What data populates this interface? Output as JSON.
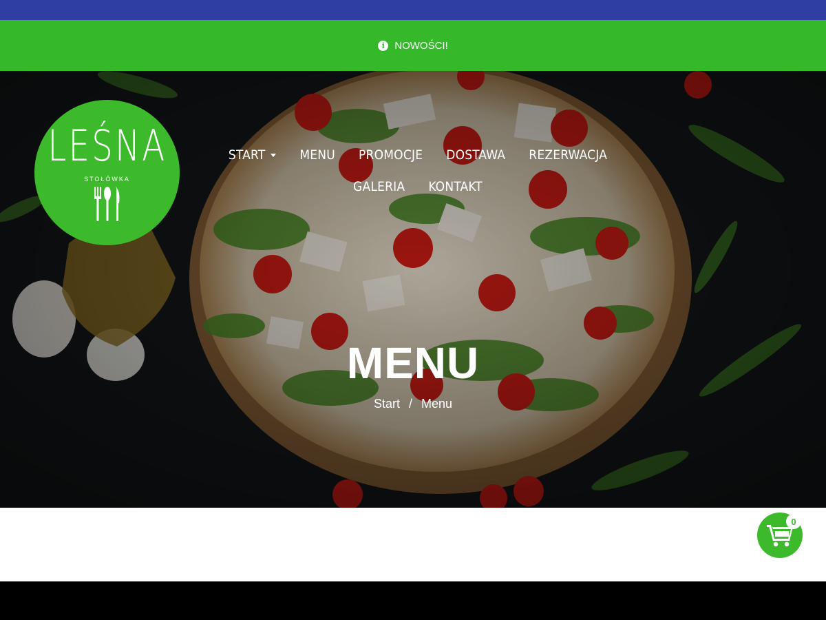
{
  "notice": {
    "icon": "info-icon",
    "text": "NOWOŚCI!"
  },
  "logo": {
    "brand": "LEŚNA",
    "subtitle": "STOŁÓWKA",
    "icon": "cutlery-icon"
  },
  "nav": {
    "row1": [
      "START",
      "MENU",
      "PROMOCJE",
      "DOSTAWA",
      "REZERWACJA"
    ],
    "row2": [
      "GALERIA",
      "KONTAKT"
    ]
  },
  "page": {
    "title": "MENU"
  },
  "breadcrumb": {
    "home": "Start",
    "separator": "/",
    "current": "Menu"
  },
  "cart": {
    "icon": "cart-icon",
    "count": "0"
  },
  "colors": {
    "topbar": "#2f3ea3",
    "accent": "#35b82a",
    "logo": "#3dba2c"
  }
}
